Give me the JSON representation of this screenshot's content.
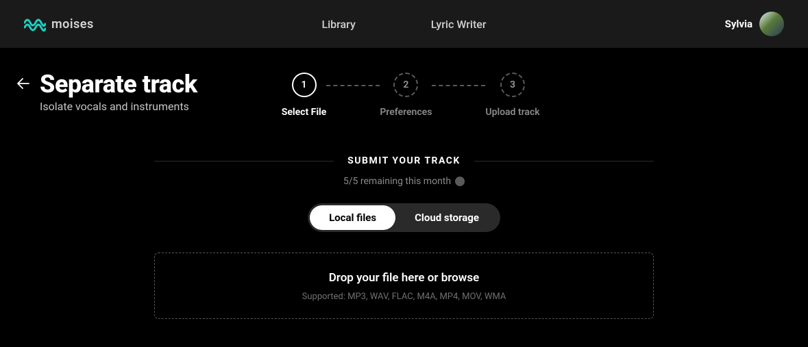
{
  "brand": {
    "name": "moises"
  },
  "nav": {
    "library": "Library",
    "lyric_writer": "Lyric Writer"
  },
  "user": {
    "name": "Sylvia"
  },
  "page": {
    "title": "Separate track",
    "subtitle": "Isolate vocals and instruments"
  },
  "steps": [
    {
      "num": "1",
      "label": "Select File",
      "active": true
    },
    {
      "num": "2",
      "label": "Preferences",
      "active": false
    },
    {
      "num": "3",
      "label": "Upload track",
      "active": false
    }
  ],
  "submit": {
    "heading": "SUBMIT YOUR TRACK",
    "remaining": "5/5 remaining this month"
  },
  "source_toggle": {
    "local": "Local files",
    "cloud": "Cloud storage"
  },
  "dropzone": {
    "text": "Drop your file here or browse",
    "supported": "Supported: MP3, WAV, FLAC, M4A, MP4, MOV, WMA"
  }
}
